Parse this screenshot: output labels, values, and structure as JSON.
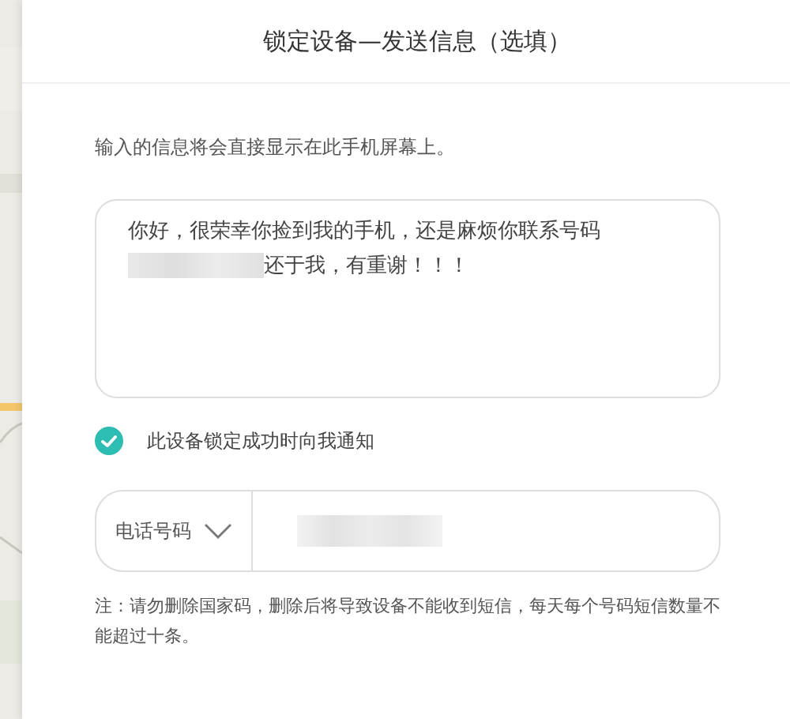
{
  "dialog": {
    "title": "锁定设备—发送信息（选填）"
  },
  "hint": "输入的信息将会直接显示在此手机屏幕上。",
  "message": {
    "lines": [
      "你好，很荣幸你捡到我的手机，还是麻烦你联系号码",
      "还于我，有重谢！！！"
    ]
  },
  "notify": {
    "label": "此设备锁定成功时向我通知",
    "checked": true
  },
  "phone": {
    "type_label": "电话号码"
  },
  "note": "注：请勿删除国家码，删除后将导致设备不能收到短信，每天每个号码短信数量不能超过十条。"
}
